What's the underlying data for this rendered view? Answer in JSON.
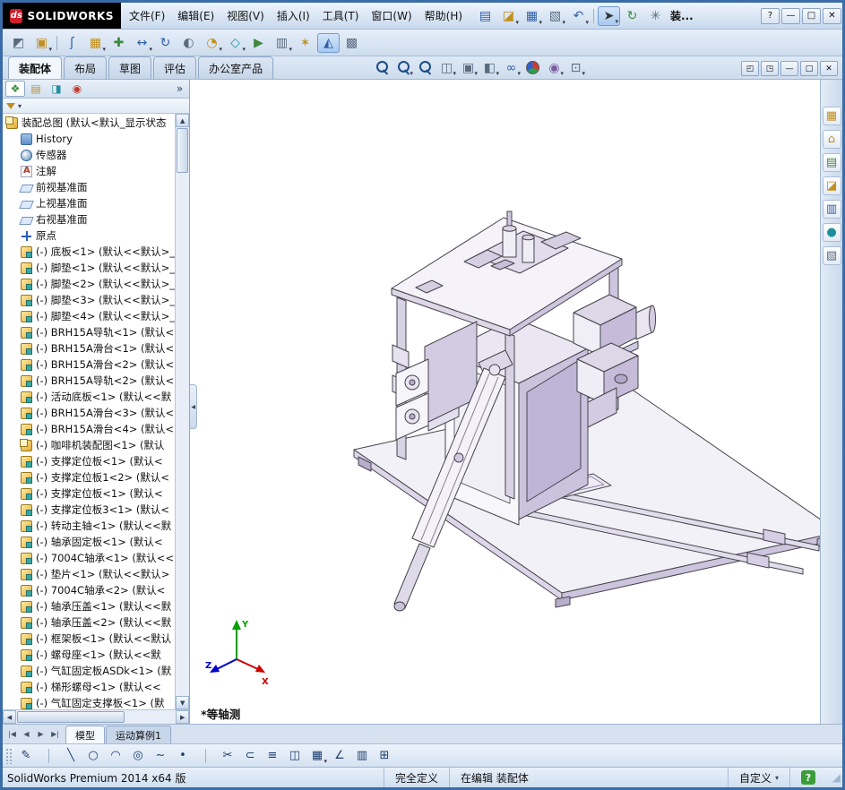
{
  "window": {
    "brand_mark": "ds",
    "brand_text": "SOLIDWORKS",
    "doc_title_short": "装...",
    "help_label": "?",
    "controls": [
      {
        "name": "window-minimize-button",
        "glyph": "—"
      },
      {
        "name": "window-maximize-button",
        "glyph": "□"
      },
      {
        "name": "window-close-button",
        "glyph": "✕"
      }
    ]
  },
  "menu_bar": {
    "items": [
      "文件(F)",
      "编辑(E)",
      "视图(V)",
      "插入(I)",
      "工具(T)",
      "窗口(W)",
      "帮助(H)"
    ]
  },
  "quick_toolbar": {
    "items": [
      {
        "name": "new-document-icon",
        "glyph": "▤",
        "tone": "tone-blue"
      },
      {
        "name": "open-document-icon",
        "glyph": "◪",
        "tone": "tone-gold",
        "dd": "has-dd"
      },
      {
        "name": "save-icon",
        "glyph": "▦",
        "tone": "tone-blue",
        "dd": "has-dd"
      },
      {
        "name": "print-icon",
        "glyph": "▧",
        "tone": "tone-slate",
        "dd": "has-dd"
      },
      {
        "name": "undo-icon",
        "glyph": "↶",
        "tone": "tone-blue",
        "dd": "has-dd"
      },
      {
        "name": "quick-toolbar-separator",
        "sep": "sep"
      },
      {
        "name": "select-cursor-icon",
        "glyph": "➤",
        "tone": "tone-dark",
        "dd": "has-dd",
        "state": "active"
      },
      {
        "name": "rebuild-icon",
        "glyph": "↻",
        "tone": "tone-green"
      },
      {
        "name": "file-properties-icon",
        "glyph": "✳",
        "tone": "tone-slate"
      }
    ]
  },
  "assembly_toolbar": {
    "items": [
      {
        "name": "edit-component-icon",
        "glyph": "◩",
        "tone": "tone-slate"
      },
      {
        "name": "insert-component-icon",
        "glyph": "▣",
        "tone": "tone-gold",
        "dd": "has-dd"
      },
      {
        "name": "toolbar-separator",
        "sep": "sep"
      },
      {
        "name": "mate-icon",
        "glyph": "ʃ",
        "tone": "tone-blue"
      },
      {
        "name": "component-pattern-icon",
        "glyph": "▦",
        "tone": "tone-gold",
        "dd": "has-dd"
      },
      {
        "name": "smart-fasteners-icon",
        "glyph": "✚",
        "tone": "tone-green"
      },
      {
        "name": "move-component-icon",
        "glyph": "↔",
        "tone": "tone-blue",
        "dd": "has-dd"
      },
      {
        "name": "rotate-component-icon",
        "glyph": "↻",
        "tone": "tone-blue"
      },
      {
        "name": "show-hidden-components-icon",
        "glyph": "◐",
        "tone": "tone-slate"
      },
      {
        "name": "assembly-features-icon",
        "glyph": "◔",
        "tone": "tone-gold",
        "dd": "has-dd"
      },
      {
        "name": "reference-geometry-icon",
        "glyph": "◇",
        "tone": "tone-teal",
        "dd": "has-dd"
      },
      {
        "name": "new-motion-study-icon",
        "glyph": "▶",
        "tone": "tone-green"
      },
      {
        "name": "bill-of-materials-icon",
        "glyph": "▥",
        "tone": "tone-slate",
        "dd": "has-dd"
      },
      {
        "name": "exploded-view-icon",
        "glyph": "✶",
        "tone": "tone-gold"
      },
      {
        "name": "instant3d-icon",
        "glyph": "◭",
        "tone": "tone-blue",
        "state": "active"
      },
      {
        "name": "large-assembly-mode-icon",
        "glyph": "▩",
        "tone": "tone-slate"
      }
    ]
  },
  "command_tabs": {
    "items": [
      {
        "label": "装配体",
        "state": "active"
      },
      {
        "label": "布局"
      },
      {
        "label": "草图"
      },
      {
        "label": "评估"
      },
      {
        "label": "办公室产品"
      }
    ]
  },
  "heads_up": {
    "items": [
      {
        "name": "zoom-fit-icon",
        "shape": "shape-mag"
      },
      {
        "name": "zoom-area-icon",
        "shape": "shape-mag",
        "dd": "has-dd"
      },
      {
        "name": "previous-view-icon",
        "shape": "shape-mag"
      },
      {
        "name": "section-view-icon",
        "glyph": "◫",
        "tone": "tone-slate",
        "dd": "has-dd"
      },
      {
        "name": "view-orientation-icon",
        "glyph": "▣",
        "tone": "tone-slate",
        "dd": "has-dd"
      },
      {
        "name": "display-style-icon",
        "glyph": "◧",
        "tone": "tone-slate",
        "dd": "has-dd"
      },
      {
        "name": "hide-show-items-icon",
        "glyph": "∞",
        "tone": "tone-blue",
        "dd": "has-dd"
      },
      {
        "name": "edit-appearance-icon",
        "shape": "shape-wheel"
      },
      {
        "name": "apply-scene-icon",
        "glyph": "◉",
        "tone": "tone-purple",
        "dd": "has-dd"
      },
      {
        "name": "view-settings-icon",
        "glyph": "⊡",
        "tone": "tone-slate",
        "dd": "has-dd"
      }
    ]
  },
  "mdi_controls": {
    "items": [
      {
        "name": "viewport-split-icon",
        "glyph": "◰"
      },
      {
        "name": "viewport-pane-icon",
        "glyph": "◳"
      },
      {
        "name": "document-minimize-button",
        "glyph": "—"
      },
      {
        "name": "document-restore-button",
        "glyph": "□"
      },
      {
        "name": "document-close-button",
        "glyph": "✕"
      }
    ]
  },
  "panel_tabs": {
    "items": [
      {
        "name": "featuremanager-tab-icon",
        "glyph": "❖",
        "tone": "tone-green",
        "state": "active"
      },
      {
        "name": "propertymanager-tab-icon",
        "glyph": "▤",
        "tone": "tone-gold"
      },
      {
        "name": "configurationmanager-tab-icon",
        "glyph": "◨",
        "tone": "tone-teal"
      },
      {
        "name": "displaymanager-tab-icon",
        "glyph": "◉",
        "tone": "tone-red"
      }
    ],
    "overflow_glyph": "»"
  },
  "feature_tree": {
    "root_label": "装配总图 (默认<默认_显示状态",
    "items": [
      {
        "icon": "history-icon",
        "label": "History"
      },
      {
        "icon": "sensor-icon",
        "label": "传感器"
      },
      {
        "icon": "annotation-icon",
        "label": "注解"
      },
      {
        "icon": "plane-icon",
        "label": "前视基准面"
      },
      {
        "icon": "plane-icon",
        "label": "上视基准面"
      },
      {
        "icon": "plane-icon",
        "label": "右视基准面"
      },
      {
        "icon": "origin-icon",
        "label": "原点"
      },
      {
        "icon": "part-icon",
        "label": "(-) 底板<1> (默认<<默认>_"
      },
      {
        "icon": "part-icon",
        "label": "(-) 脚垫<1> (默认<<默认>_"
      },
      {
        "icon": "part-icon",
        "label": "(-) 脚垫<2> (默认<<默认>_"
      },
      {
        "icon": "part-icon",
        "label": "(-) 脚垫<3> (默认<<默认>_"
      },
      {
        "icon": "part-icon",
        "label": "(-) 脚垫<4> (默认<<默认>_"
      },
      {
        "icon": "part-icon",
        "label": "(-) BRH15A导轨<1> (默认<"
      },
      {
        "icon": "part-icon",
        "label": "(-) BRH15A滑台<1> (默认<"
      },
      {
        "icon": "part-icon",
        "label": "(-) BRH15A滑台<2> (默认<"
      },
      {
        "icon": "part-icon",
        "label": "(-) BRH15A导轨<2> (默认<"
      },
      {
        "icon": "part-icon",
        "label": "(-) 活动底板<1> (默认<<默"
      },
      {
        "icon": "part-icon",
        "label": "(-) BRH15A滑台<3> (默认<"
      },
      {
        "icon": "part-icon",
        "label": "(-) BRH15A滑台<4> (默认<"
      },
      {
        "icon": "assembly-icon",
        "label": "(-) 咖啡机装配图<1> (默认"
      },
      {
        "icon": "part-icon",
        "label": "(-) 支撑定位板<1> (默认<"
      },
      {
        "icon": "part-icon",
        "label": "(-) 支撑定位板1<2> (默认<"
      },
      {
        "icon": "part-icon",
        "label": "(-) 支撑定位板<1> (默认<"
      },
      {
        "icon": "part-icon",
        "label": "(-) 支撑定位板3<1> (默认<"
      },
      {
        "icon": "part-icon",
        "label": "(-) 转动主轴<1> (默认<<默"
      },
      {
        "icon": "part-icon",
        "label": "(-) 轴承固定板<1> (默认<"
      },
      {
        "icon": "part-icon",
        "label": "(-) 7004C轴承<1> (默认<<"
      },
      {
        "icon": "part-icon",
        "label": "(-) 垫片<1> (默认<<默认>"
      },
      {
        "icon": "part-icon",
        "label": "(-) 7004C轴承<2> (默认<"
      },
      {
        "icon": "part-icon",
        "label": "(-) 轴承压盖<1> (默认<<默"
      },
      {
        "icon": "part-icon",
        "label": "(-) 轴承压盖<2> (默认<<默"
      },
      {
        "icon": "part-icon",
        "label": "(-) 框架板<1> (默认<<默认"
      },
      {
        "icon": "part-icon",
        "label": "(-) 螺母座<1> (默认<<默"
      },
      {
        "icon": "part-icon",
        "label": "(-) 气缸固定板ASDk<1> (默"
      },
      {
        "icon": "part-icon",
        "label": "(-) 梯形螺母<1> (默认<<"
      },
      {
        "icon": "part-icon",
        "label": "(-) 气缸固定支撑板<1> (默"
      }
    ]
  },
  "task_pane": {
    "items": [
      {
        "name": "solidworks-resources-icon",
        "glyph": "▦",
        "tone": "tone-gold"
      },
      {
        "name": "design-library-icon",
        "glyph": "⌂",
        "tone": "tone-gold"
      },
      {
        "name": "file-explorer-icon",
        "glyph": "▤",
        "tone": "tone-green"
      },
      {
        "name": "view-palette-icon",
        "glyph": "◪",
        "tone": "tone-gold"
      },
      {
        "name": "appearances-scenes-icon",
        "glyph": "▥",
        "tone": "tone-blue"
      },
      {
        "name": "custom-properties-icon",
        "glyph": "●",
        "tone": "tone-teal"
      },
      {
        "name": "document-recovery-icon",
        "glyph": "▧",
        "tone": "tone-slate"
      }
    ]
  },
  "viewport": {
    "view_orientation_label": "*等轴测",
    "triad": {
      "x_label": "X",
      "y_label": "Y",
      "z_label": "Z"
    }
  },
  "model_tabs": {
    "nav": [
      "|◀",
      "◀",
      "▶",
      "▶|"
    ],
    "items": [
      {
        "label": "模型",
        "state": "active"
      },
      {
        "label": "运动算例1"
      }
    ]
  },
  "sketch_toolbar": {
    "items": [
      {
        "name": "sketch-icon",
        "glyph": "✎"
      },
      {
        "name": "sketch-separator",
        "sep": "sep"
      },
      {
        "name": "line-icon",
        "glyph": "╲"
      },
      {
        "name": "circle-icon",
        "glyph": "○"
      },
      {
        "name": "arc-icon",
        "glyph": "◠"
      },
      {
        "name": "ellipse-icon",
        "glyph": "◎"
      },
      {
        "name": "spline-icon",
        "glyph": "∼"
      },
      {
        "name": "point-icon",
        "glyph": "•"
      },
      {
        "name": "sketch-separator",
        "sep": "sep"
      },
      {
        "name": "trim-entities-icon",
        "glyph": "✂"
      },
      {
        "name": "convert-entities-icon",
        "glyph": "⊂"
      },
      {
        "name": "offset-entities-icon",
        "glyph": "≡"
      },
      {
        "name": "mirror-entities-icon",
        "glyph": "◫"
      },
      {
        "name": "linear-sketch-pattern-icon",
        "glyph": "▦",
        "dd": "has-dd"
      },
      {
        "name": "smart-dimension-icon",
        "glyph": "∠"
      },
      {
        "name": "grid-system-icon",
        "glyph": "▥"
      },
      {
        "name": "rapid-sketch-icon",
        "glyph": "⊞"
      }
    ]
  },
  "status_bar": {
    "product": "SolidWorks Premium 2014 x64 版",
    "definition_state": "完全定义",
    "edit_state": "在编辑 装配体",
    "custom_label": "自定义",
    "tip_badge": "?"
  }
}
